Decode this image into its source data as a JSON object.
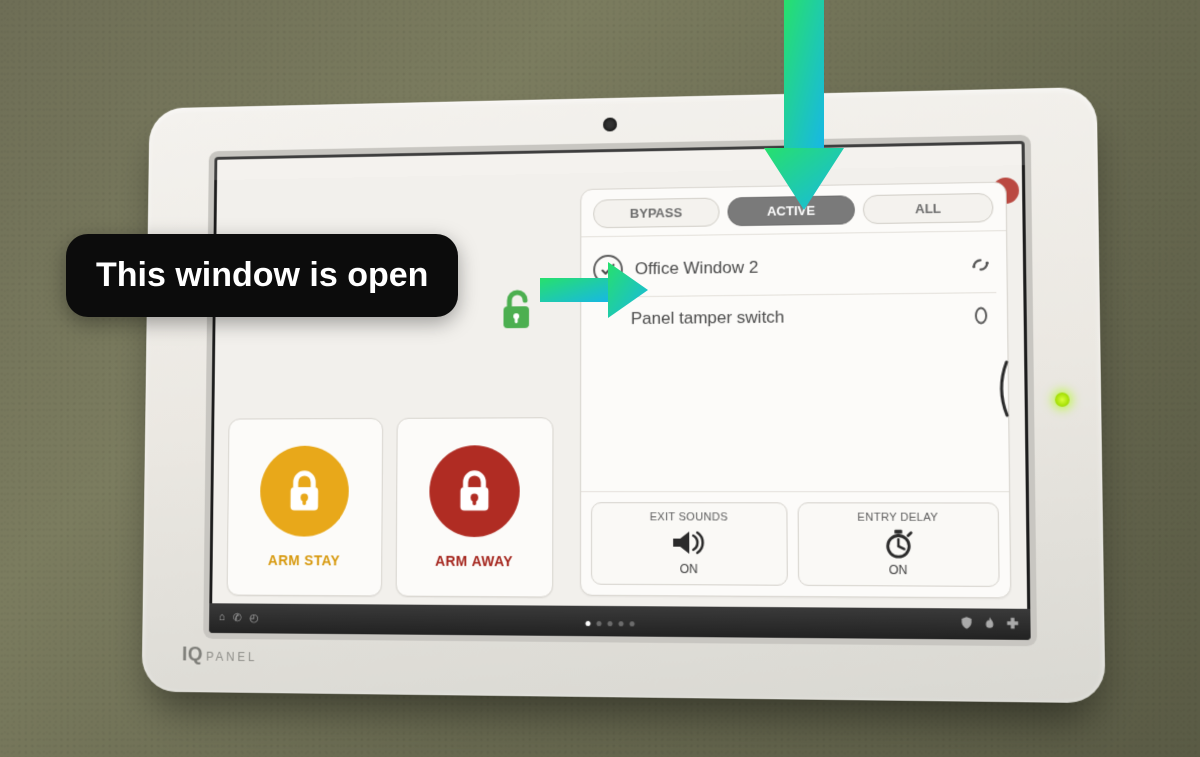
{
  "device": {
    "brand_prefix": "IQ",
    "brand_suffix": "PANEL"
  },
  "arm": {
    "stay_label": "ARM STAY",
    "away_label": "ARM AWAY"
  },
  "sensors": {
    "tabs": {
      "bypass": "BYPASS",
      "active": "ACTIVE",
      "all": "ALL"
    },
    "rows": [
      {
        "name": "Office Window 2",
        "state_icon": "sensor-open-icon"
      },
      {
        "name": "Panel tamper switch",
        "state_icon": "sensor-tamper-icon"
      }
    ]
  },
  "toggles": {
    "exit_sounds": {
      "title": "EXIT SOUNDS",
      "state": "ON"
    },
    "entry_delay": {
      "title": "ENTRY DELAY",
      "state": "ON"
    }
  },
  "annotation": {
    "callout_text": "This window is open"
  }
}
